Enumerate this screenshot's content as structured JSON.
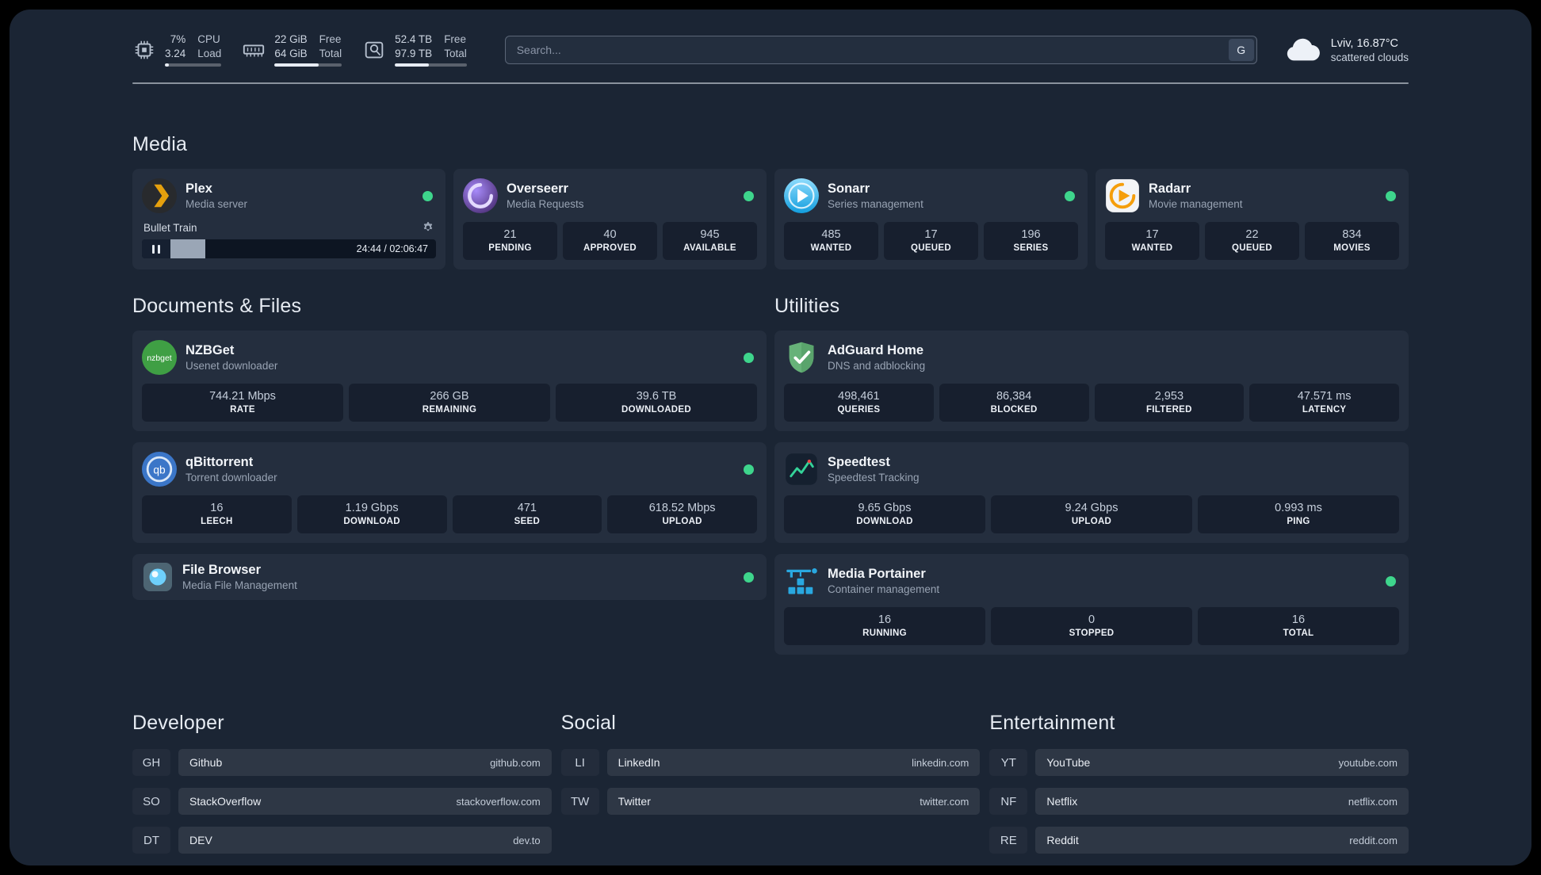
{
  "colors": {
    "status_online": "#3ed58c",
    "panel_bg": "#1b2534",
    "card_bg": "#242e3e"
  },
  "topbar": {
    "stats": [
      {
        "icon": "cpu-icon",
        "value1": "7%",
        "label1": "CPU",
        "value2": "3.24",
        "label2": "Load",
        "meter": 7
      },
      {
        "icon": "memory-icon",
        "value1": "22 GiB",
        "label1": "Free",
        "value2": "64 GiB",
        "label2": "Total",
        "meter": 66
      },
      {
        "icon": "disk-icon",
        "value1": "52.4 TB",
        "label1": "Free",
        "value2": "97.9 TB",
        "label2": "Total",
        "meter": 47
      }
    ],
    "search": {
      "placeholder": "Search...",
      "provider": "G"
    },
    "weather": {
      "icon": "cloud-icon",
      "location": "Lviv, 16.87°C",
      "condition": "scattered clouds"
    }
  },
  "media": {
    "heading": "Media",
    "plex": {
      "icon": "plex-icon",
      "name": "Plex",
      "subtitle": "Media server",
      "now_playing": "Bullet Train",
      "elapsed_total": "24:44 / 02:06:47",
      "progress_percent": 19.5
    },
    "overseerr": {
      "icon": "overseerr-icon",
      "name": "Overseerr",
      "subtitle": "Media Requests",
      "stats": [
        {
          "value": "21",
          "label": "PENDING"
        },
        {
          "value": "40",
          "label": "APPROVED"
        },
        {
          "value": "945",
          "label": "AVAILABLE"
        }
      ]
    },
    "sonarr": {
      "icon": "sonarr-icon",
      "name": "Sonarr",
      "subtitle": "Series management",
      "stats": [
        {
          "value": "485",
          "label": "WANTED"
        },
        {
          "value": "17",
          "label": "QUEUED"
        },
        {
          "value": "196",
          "label": "SERIES"
        }
      ]
    },
    "radarr": {
      "icon": "radarr-icon",
      "name": "Radarr",
      "subtitle": "Movie management",
      "stats": [
        {
          "value": "17",
          "label": "WANTED"
        },
        {
          "value": "22",
          "label": "QUEUED"
        },
        {
          "value": "834",
          "label": "MOVIES"
        }
      ]
    }
  },
  "documents": {
    "heading": "Documents & Files",
    "nzbget": {
      "icon": "nzbget-icon",
      "name": "NZBGet",
      "subtitle": "Usenet downloader",
      "stats": [
        {
          "value": "744.21 Mbps",
          "label": "RATE"
        },
        {
          "value": "266 GB",
          "label": "REMAINING"
        },
        {
          "value": "39.6 TB",
          "label": "DOWNLOADED"
        }
      ]
    },
    "qbittorrent": {
      "icon": "qbittorrent-icon",
      "name": "qBittorrent",
      "subtitle": "Torrent downloader",
      "stats": [
        {
          "value": "16",
          "label": "LEECH"
        },
        {
          "value": "1.19 Gbps",
          "label": "DOWNLOAD"
        },
        {
          "value": "471",
          "label": "SEED"
        },
        {
          "value": "618.52 Mbps",
          "label": "UPLOAD"
        }
      ]
    },
    "filebrowser": {
      "icon": "filebrowser-icon",
      "name": "File Browser",
      "subtitle": "Media File Management"
    }
  },
  "utilities": {
    "heading": "Utilities",
    "adguard": {
      "icon": "adguard-icon",
      "name": "AdGuard Home",
      "subtitle": "DNS and adblocking",
      "stats": [
        {
          "value": "498,461",
          "label": "QUERIES"
        },
        {
          "value": "86,384",
          "label": "BLOCKED"
        },
        {
          "value": "2,953",
          "label": "FILTERED"
        },
        {
          "value": "47.571 ms",
          "label": "LATENCY"
        }
      ]
    },
    "speedtest": {
      "icon": "speedtest-icon",
      "name": "Speedtest",
      "subtitle": "Speedtest Tracking",
      "stats": [
        {
          "value": "9.65 Gbps",
          "label": "DOWNLOAD"
        },
        {
          "value": "9.24 Gbps",
          "label": "UPLOAD"
        },
        {
          "value": "0.993 ms",
          "label": "PING"
        }
      ]
    },
    "portainer": {
      "icon": "portainer-icon",
      "name": "Media Portainer",
      "subtitle": "Container management",
      "stats": [
        {
          "value": "16",
          "label": "RUNNING"
        },
        {
          "value": "0",
          "label": "STOPPED"
        },
        {
          "value": "16",
          "label": "TOTAL"
        }
      ]
    }
  },
  "bookmarks": {
    "developer": {
      "heading": "Developer",
      "items": [
        {
          "abbr": "GH",
          "name": "Github",
          "url": "github.com"
        },
        {
          "abbr": "SO",
          "name": "StackOverflow",
          "url": "stackoverflow.com"
        },
        {
          "abbr": "DT",
          "name": "DEV",
          "url": "dev.to"
        }
      ]
    },
    "social": {
      "heading": "Social",
      "items": [
        {
          "abbr": "LI",
          "name": "LinkedIn",
          "url": "linkedin.com"
        },
        {
          "abbr": "TW",
          "name": "Twitter",
          "url": "twitter.com"
        }
      ]
    },
    "entertainment": {
      "heading": "Entertainment",
      "items": [
        {
          "abbr": "YT",
          "name": "YouTube",
          "url": "youtube.com"
        },
        {
          "abbr": "NF",
          "name": "Netflix",
          "url": "netflix.com"
        },
        {
          "abbr": "RE",
          "name": "Reddit",
          "url": "reddit.com"
        }
      ]
    }
  }
}
